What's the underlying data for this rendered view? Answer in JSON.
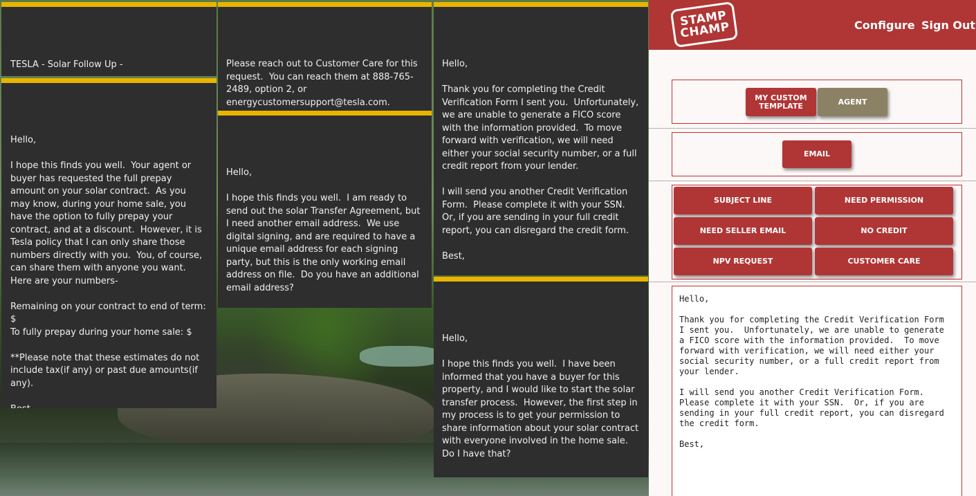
{
  "cards": {
    "subject": "TESLA - Solar Follow Up -",
    "customer_care": "Please reach out to Customer Care for this request.  You can reach them at 888-765-2489, option 2, or energycustomersupport@tesla.com.",
    "no_credit": "Hello,\n\nThank you for completing the Credit Verification Form I sent you.  Unfortunately, we are unable to generate a FICO score with the information provided.  To move forward with verification, we will need either your social security number, or a full credit report from your lender.\n\nI will send you another Credit Verification Form.  Please complete it with your SSN.  Or, if you are sending in your full credit report, you can disregard the credit form.\n\nBest,",
    "npv_request": "Hello,\n\nI hope this finds you well.  Your agent or buyer has requested the full prepay amount on your solar contract.  As you may know, during your home sale, you have the option to fully prepay your contract, and at a discount.  However, it is Tesla policy that I can only share those numbers directly with you.  You, of course, can share them with anyone you want.  Here are your numbers-\n\nRemaining on your contract to end of term: $\nTo fully prepay during your home sale: $\n\n**Please note that these estimates do not include tax(if any) or past due amounts(if any).\n\nBest,",
    "need_seller_email": "Hello,\n\nI hope this finds you well.  I am ready to send out the solar Transfer Agreement, but I need another email address.  We use digital signing, and are required to have a unique email address for each signing party, but this is the only working email address on file.  Do you have an additional email address?",
    "need_permission": "Hello,\n\nI hope this finds you well.  I have been informed that you have a buyer for this property, and I would like to start the solar transfer process.  However, the first step in my process is to get your permission to share information about your solar contract with everyone involved in the home sale.  Do I have that?"
  },
  "header": {
    "logo_line1": "STAMP",
    "logo_line2": "CHAMP",
    "configure": "Configure",
    "sign_out": "Sign Out",
    "accent_color": "#b03535"
  },
  "template_tabs": {
    "my_custom": "MY CUSTOM TEMPLATE",
    "agent": "AGENT"
  },
  "channel": {
    "email": "EMAIL"
  },
  "template_buttons": [
    "SUBJECT LINE",
    "NEED PERMISSION",
    "NEED SELLER EMAIL",
    "NO CREDIT",
    "NPV REQUEST",
    "CUSTOMER CARE"
  ],
  "preview": {
    "text": "Hello,\n\nThank you for completing the Credit Verification Form\nI sent you.  Unfortunately, we are unable to generate\na FICO score with the information provided.  To move\nforward with verification, we will need either your\nsocial security number, or a full credit report from\nyour lender.\n\nI will send you another Credit Verification Form.\nPlease complete it with your SSN.  Or, if you are\nsending in your full credit report, you can disregard\nthe credit form.\n\nBest,"
  }
}
